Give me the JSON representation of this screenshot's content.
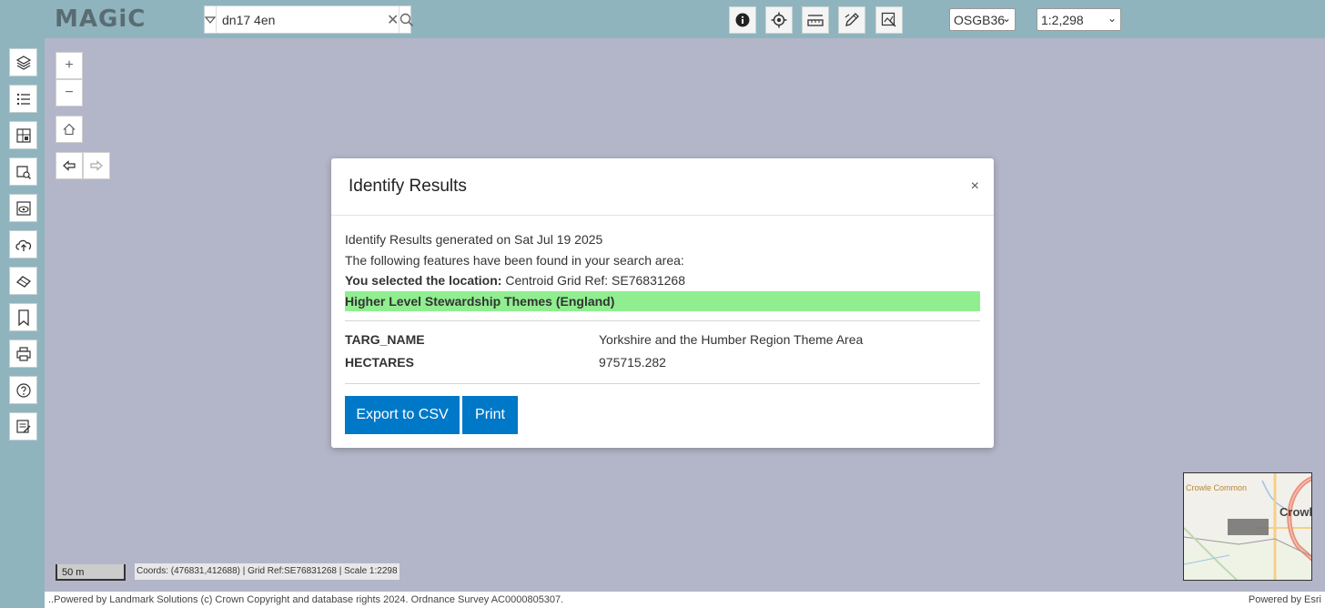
{
  "app": {
    "logo": "MAGiC"
  },
  "search": {
    "value": "dn17 4en"
  },
  "toolbar": {
    "tools": [
      {
        "name": "identify-tool",
        "icon": "info-icon"
      },
      {
        "name": "locate-tool",
        "icon": "crosshair-icon"
      },
      {
        "name": "measure-tool",
        "icon": "ruler-icon"
      },
      {
        "name": "draw-tool",
        "icon": "pencil-icon"
      },
      {
        "name": "select-tool",
        "icon": "select-map-icon"
      }
    ],
    "projection": "OSGB36",
    "scale": "1:2,298"
  },
  "sidebar": {
    "items": [
      {
        "name": "layers",
        "icon": "layers-icon"
      },
      {
        "name": "legend",
        "icon": "list-icon"
      },
      {
        "name": "basemap",
        "icon": "map-icon"
      },
      {
        "name": "search-area",
        "icon": "map-search-icon"
      },
      {
        "name": "view-layer",
        "icon": "eye-map-icon"
      },
      {
        "name": "upload",
        "icon": "cloud-upload-icon"
      },
      {
        "name": "eraser",
        "icon": "eraser-icon"
      },
      {
        "name": "bookmarks",
        "icon": "bookmark-icon"
      },
      {
        "name": "print",
        "icon": "printer-icon"
      },
      {
        "name": "help",
        "icon": "help-icon"
      },
      {
        "name": "report",
        "icon": "report-icon"
      }
    ]
  },
  "dialog": {
    "title": "Identify Results",
    "close": "×",
    "generated": "Identify Results generated on Sat Jul 19 2025",
    "found": "The following features have been found in your search area:",
    "selected_label": "You selected the location:",
    "selected_value": " Centroid Grid Ref: SE76831268",
    "theme": "Higher Level Stewardship Themes (England)",
    "attributes": [
      {
        "key": "TARG_NAME",
        "value": "Yorkshire and the Humber Region Theme Area"
      },
      {
        "key": "HECTARES",
        "value": "975715.282"
      }
    ],
    "export_button": "Export to CSV",
    "print_button": "Print"
  },
  "map": {
    "scalebar": "50 m",
    "coords": "Coords: (476831,412688) | Grid Ref:SE76831268 | Scale 1:2298",
    "overview_labels": [
      "Crowle Common",
      "Crowl"
    ]
  },
  "footer": {
    "left": "..Powered by Landmark Solutions (c) Crown Copyright and database rights 2024. Ordnance Survey AC0000805307.",
    "right": "Powered by Esri"
  },
  "colors": {
    "teal": "#8fb4bd",
    "map_bg": "#b3b6c8",
    "theme_highlight": "#90ee90",
    "button_blue": "#0078c8"
  }
}
